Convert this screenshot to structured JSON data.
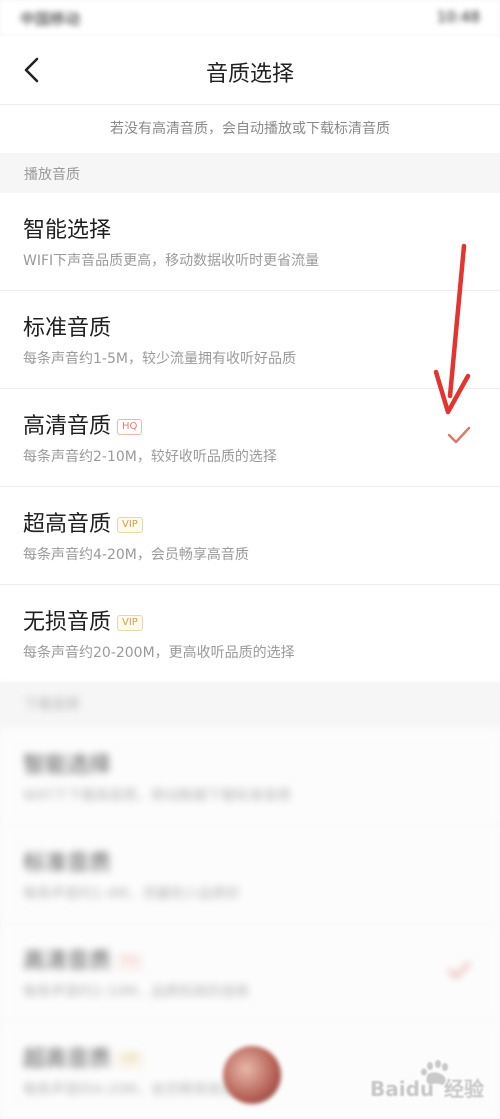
{
  "status_bar": {
    "carrier": "中国移动",
    "time": "10:48"
  },
  "header": {
    "title": "音质选择"
  },
  "notice": "若没有高清音质，会自动播放或下载标清音质",
  "play_section": {
    "label": "播放音质",
    "items": [
      {
        "name": "智能选择",
        "desc": "WIFI下声音品质更高，移动数据收听时更省流量",
        "badge": "",
        "selected": false
      },
      {
        "name": "标准音质",
        "desc": "每条声音约1-5M，较少流量拥有收听好品质",
        "badge": "",
        "selected": false
      },
      {
        "name": "高清音质",
        "desc": "每条声音约2-10M，较好收听品质的选择",
        "badge": "HQ",
        "selected": true
      },
      {
        "name": "超高音质",
        "desc": "每条声音约4-20M，会员畅享高音质",
        "badge": "VIP",
        "selected": false
      },
      {
        "name": "无损音质",
        "desc": "每条声音约20-200M，更高收听品质的选择",
        "badge": "VIP",
        "selected": false
      }
    ]
  },
  "download_section": {
    "label": "下载音质",
    "items": [
      {
        "name": "智能选择",
        "desc": "WIFI下下载高音质，移动数据下载标准音质",
        "badge": "",
        "selected": false
      },
      {
        "name": "标准音质",
        "desc": "每条声音约1-4M，流量较少品质好",
        "badge": "",
        "selected": false
      },
      {
        "name": "高清音质",
        "desc": "每条声音约2-10M，品质较高的选择",
        "badge": "HQ",
        "selected": true
      },
      {
        "name": "超高音质",
        "desc": "每条声音约4-20M，会员畅享高音质",
        "badge": "VIP",
        "selected": false
      }
    ]
  },
  "watermark": {
    "brand": "Baidu",
    "sub": "经验"
  },
  "colors": {
    "accent": "#e67c6e",
    "vip": "#c9a24e",
    "arrow": "#e3342f"
  }
}
